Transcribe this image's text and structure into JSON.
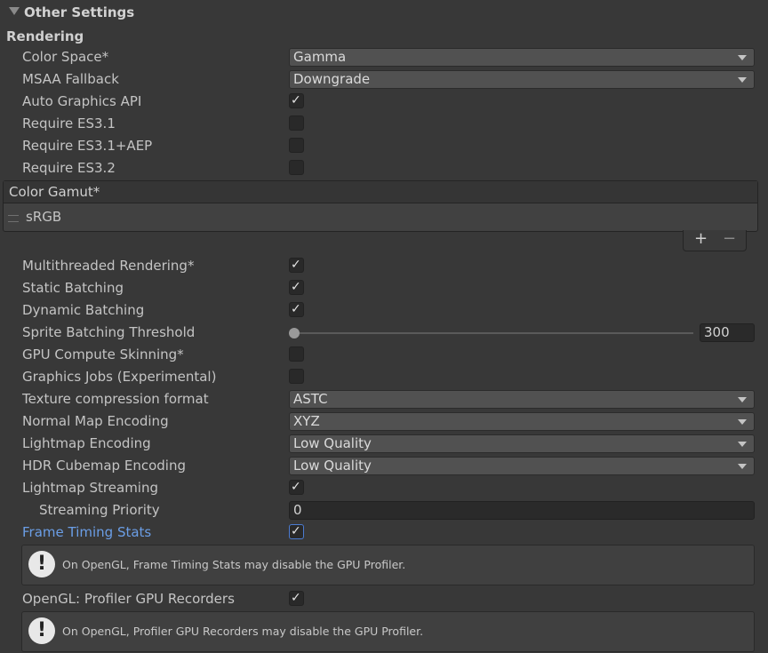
{
  "header": {
    "title": "Other Settings"
  },
  "section": {
    "rendering": "Rendering"
  },
  "rows": {
    "color_space": {
      "label": "Color Space*",
      "value": "Gamma"
    },
    "msaa_fallback": {
      "label": "MSAA Fallback",
      "value": "Downgrade"
    },
    "auto_graphics_api": {
      "label": "Auto Graphics API",
      "checked": true
    },
    "require_es31": {
      "label": "Require ES3.1",
      "checked": false
    },
    "require_es31_aep": {
      "label": "Require ES3.1+AEP",
      "checked": false
    },
    "require_es32": {
      "label": "Require ES3.2",
      "checked": false
    },
    "multithreaded_rendering": {
      "label": "Multithreaded Rendering*",
      "checked": true
    },
    "static_batching": {
      "label": "Static Batching",
      "checked": true
    },
    "dynamic_batching": {
      "label": "Dynamic Batching",
      "checked": true
    },
    "sprite_batching_threshold": {
      "label": "Sprite Batching Threshold",
      "value": "300"
    },
    "gpu_compute_skinning": {
      "label": "GPU Compute Skinning*",
      "checked": false
    },
    "graphics_jobs": {
      "label": "Graphics Jobs (Experimental)",
      "checked": false
    },
    "texture_compression": {
      "label": "Texture compression format",
      "value": "ASTC"
    },
    "normal_map_encoding": {
      "label": "Normal Map Encoding",
      "value": "XYZ"
    },
    "lightmap_encoding": {
      "label": "Lightmap Encoding",
      "value": "Low Quality"
    },
    "hdr_cubemap_encoding": {
      "label": "HDR Cubemap Encoding",
      "value": "Low Quality"
    },
    "lightmap_streaming": {
      "label": "Lightmap Streaming",
      "checked": true
    },
    "streaming_priority": {
      "label": "Streaming Priority",
      "value": "0"
    },
    "frame_timing_stats": {
      "label": "Frame Timing Stats",
      "checked": true
    },
    "opengl_profiler": {
      "label": "OpenGL: Profiler GPU Recorders",
      "checked": true
    }
  },
  "color_gamut": {
    "header": "Color Gamut*",
    "items": [
      "sRGB"
    ],
    "add_label": "+",
    "remove_label": "−"
  },
  "help": {
    "frame_timing": "On OpenGL, Frame Timing Stats may disable the GPU Profiler.",
    "profiler_recorders": "On OpenGL, Profiler GPU Recorders may disable the GPU Profiler.",
    "icon_glyph": "!"
  },
  "icons": {
    "checkmark": "✓",
    "collapse": "triangle-down-icon"
  },
  "colors": {
    "background": "#383838",
    "link_label": "#6b9ee6",
    "focus_border": "#4b7bd1"
  }
}
